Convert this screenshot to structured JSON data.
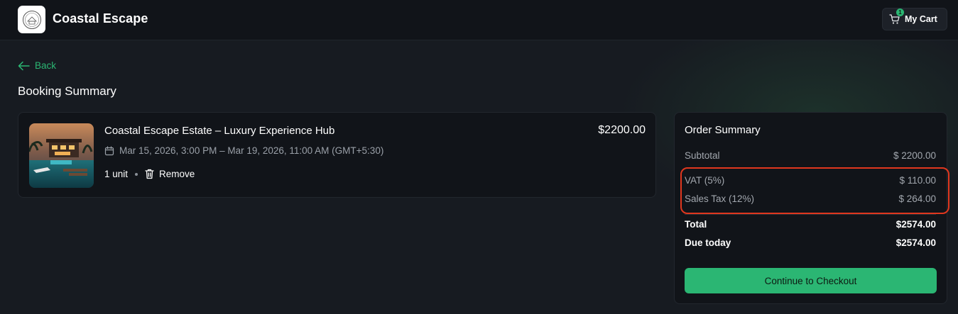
{
  "brand": {
    "name": "Coastal Escape",
    "logo_icon": "estate-seal-logo"
  },
  "header": {
    "cart_label": "My Cart",
    "cart_count": "1",
    "cart_icon": "shopping-cart-icon"
  },
  "nav": {
    "back_label": "Back",
    "back_icon": "arrow-left-icon"
  },
  "page": {
    "title": "Booking Summary"
  },
  "item": {
    "title": "Coastal Escape Estate – Luxury Experience Hub",
    "dates": "Mar 15, 2026, 3:00 PM – Mar 19, 2026, 11:00 AM (GMT+5:30)",
    "quantity": "1 unit",
    "remove_label": "Remove",
    "price": "$2200.00"
  },
  "summary": {
    "title": "Order Summary",
    "rows": [
      {
        "label": "Subtotal",
        "value": "$ 2200.00"
      },
      {
        "label": "VAT (5%)",
        "value": "$ 110.00"
      },
      {
        "label": "Sales Tax (12%)",
        "value": "$ 264.00"
      },
      {
        "label": "Total",
        "value": "$2574.00"
      },
      {
        "label": "Due today",
        "value": "$2574.00"
      }
    ],
    "checkout_label": "Continue to Checkout"
  },
  "colors": {
    "accent": "#2bb673",
    "highlight": "#e0371e",
    "background": "#171b21",
    "card": "#111419"
  }
}
